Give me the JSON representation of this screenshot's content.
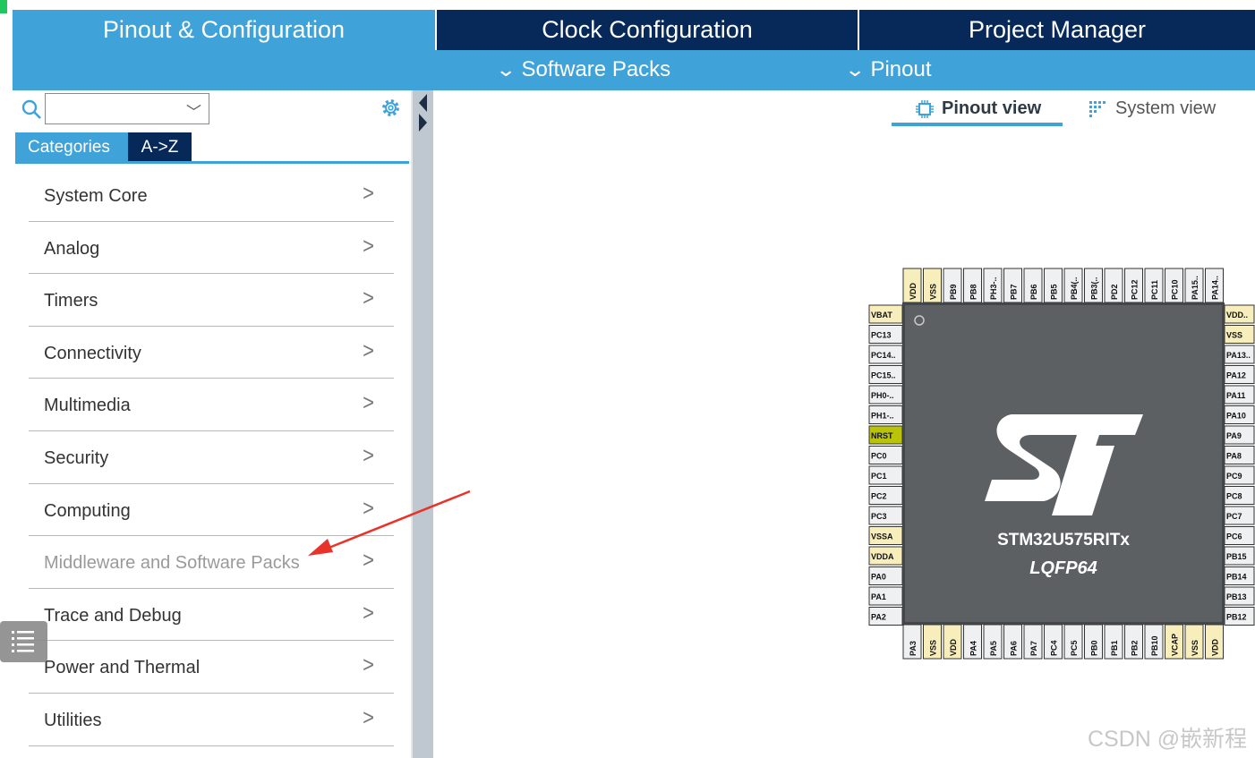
{
  "header": {
    "tabs": [
      {
        "label": "Pinout & Configuration",
        "active": true
      },
      {
        "label": "Clock Configuration",
        "active": false
      },
      {
        "label": "Project Manager",
        "active": false
      }
    ],
    "submenus": [
      {
        "label": "Software Packs"
      },
      {
        "label": "Pinout"
      }
    ]
  },
  "sidebar": {
    "search_value": "",
    "category_tabs": [
      {
        "label": "Categories",
        "active": true
      },
      {
        "label": "A->Z",
        "active": false
      }
    ],
    "items": [
      {
        "label": "System Core",
        "enabled": true
      },
      {
        "label": "Analog",
        "enabled": true
      },
      {
        "label": "Timers",
        "enabled": true
      },
      {
        "label": "Connectivity",
        "enabled": true
      },
      {
        "label": "Multimedia",
        "enabled": true
      },
      {
        "label": "Security",
        "enabled": true
      },
      {
        "label": "Computing",
        "enabled": true
      },
      {
        "label": "Middleware and Software Packs",
        "enabled": false
      },
      {
        "label": "Trace and Debug",
        "enabled": true
      },
      {
        "label": "Power and Thermal",
        "enabled": true
      },
      {
        "label": "Utilities",
        "enabled": true
      }
    ]
  },
  "views": [
    {
      "label": "Pinout view",
      "active": true
    },
    {
      "label": "System view",
      "active": false
    }
  ],
  "chip": {
    "name": "STM32U575RITx",
    "package": "LQFP64",
    "logo_text": "ST",
    "top_pins": [
      "VDD",
      "VSS",
      "PB9",
      "PB8",
      "PH3-..",
      "PB7",
      "PB6",
      "PB5",
      "PB4(..",
      "PB3(..",
      "PD2",
      "PC12",
      "PC11",
      "PC10",
      "PA15..",
      "PA14.."
    ],
    "left_pins": [
      "VBAT",
      "PC13",
      "PC14..",
      "PC15..",
      "PH0-..",
      "PH1-..",
      "NRST",
      "PC0",
      "PC1",
      "PC2",
      "PC3",
      "VSSA",
      "VDDA",
      "PA0",
      "PA1",
      "PA2"
    ],
    "right_pins": [
      "VDD..",
      "VSS",
      "PA13..",
      "PA12",
      "PA11",
      "PA10",
      "PA9",
      "PA8",
      "PC9",
      "PC8",
      "PC7",
      "PC6",
      "PB15",
      "PB14",
      "PB13",
      "PB12"
    ],
    "bottom_pins": [
      "PA3",
      "VSS",
      "VDD",
      "PA4",
      "PA5",
      "PA6",
      "PA7",
      "PC4",
      "PC5",
      "PB0",
      "PB1",
      "PB2",
      "PB10",
      "VCAP",
      "VSS",
      "VDD"
    ],
    "colors": {
      "power": "#f7eebc",
      "reset": "#b9c408",
      "io": "#eef0f2",
      "body": "#5a5d60"
    }
  },
  "watermark": "CSDN @嵌新程",
  "colors": {
    "accent": "#3fa2d9",
    "navy": "#06295a",
    "annotation_arrow": "#e8332b"
  }
}
